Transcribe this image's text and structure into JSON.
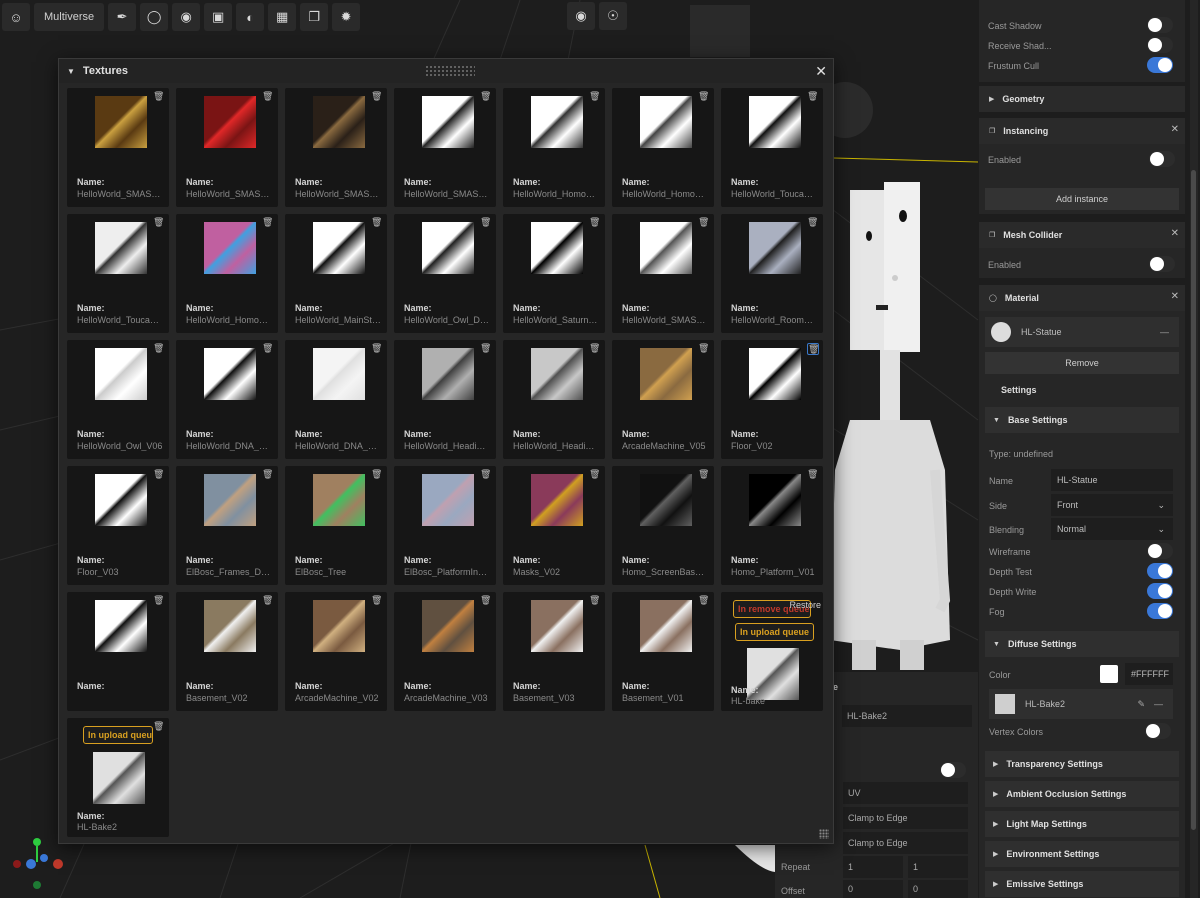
{
  "toolbar": {
    "left_text": "Multiverse",
    "icons": [
      "user-icon",
      "brush-icon",
      "bulb-icon",
      "palette-icon",
      "clapper-icon",
      "sphere-icon",
      "checker-icon",
      "copy-icon",
      "pattern-icon"
    ],
    "right_icons": [
      "orbit-icon",
      "eye-icon"
    ]
  },
  "textures": {
    "title": "Textures",
    "name_label": "Name:",
    "restore": "Restore",
    "in_upload_queue": "In upload queue",
    "in_remove_queue": "In remove queue",
    "items": [
      "HelloWorld_SMASH_...",
      "HelloWorld_SMASH_F...",
      "HelloWorld_SMASH_T...",
      "HelloWorld_SMASH_V...",
      "HelloWorld_Homo_St...",
      "HelloWorld_Homo_St...",
      "HelloWorld_ToucanSt...",
      "HelloWorld_ToucanRo...",
      "HelloWorld_Homo_M...",
      "HelloWorld_MainStat...",
      "HelloWorld_Owl_Diffu...",
      "HelloWorld_Saturn_Di...",
      "HelloWorld_SMASH_V...",
      "HelloWorld_Room_Tu...",
      "HelloWorld_Owl_V06",
      "HelloWorld_DNA_V01",
      "HelloWorld_DNA_V02",
      "HelloWorld_Headings",
      "HelloWorld_Headings...",
      "ArcadeMachine_V05",
      "Floor_V02",
      "Floor_V03",
      "ElBosc_Frames_Diffu...",
      "ElBosc_Tree",
      "ElBosc_PlatformInner...",
      "Masks_V02",
      "Homo_ScreenBase_V01",
      "Homo_Platform_V01",
      "",
      "Basement_V02",
      "ArcadeMachine_V02",
      "ArcadeMachine_V03",
      "Basement_V03",
      "Basement_V01",
      "HL-bake",
      "HL-Bake2"
    ]
  },
  "right_panel": {
    "cast_shadow": "Cast Shadow",
    "receive_shadow": "Receive Shad...",
    "frustum_cull": "Frustum Cull",
    "geometry": "Geometry",
    "instancing": "Instancing",
    "enabled": "Enabled",
    "add_instance": "Add instance",
    "mesh_collider": "Mesh Collider",
    "material": "Material",
    "material_name": "HL-Statue",
    "remove": "Remove",
    "settings": "Settings",
    "base_settings": "Base Settings",
    "type": "Type: undefined",
    "name_label": "Name",
    "name_value": "HL-Statue",
    "side_label": "Side",
    "side_value": "Front",
    "blending_label": "Blending",
    "blending_value": "Normal",
    "wireframe": "Wireframe",
    "depth_test": "Depth Test",
    "depth_write": "Depth Write",
    "fog": "Fog",
    "diffuse_settings": "Diffuse Settings",
    "color_label": "Color",
    "color_value": "#FFFFFF",
    "map_name": "HL-Bake2",
    "vertex_colors": "Vertex Colors",
    "transparency": "Transparency Settings",
    "ao": "Ambient Occlusion Settings",
    "lightmap": "Light Map Settings",
    "environment": "Environment Settings",
    "emissive": "Emissive Settings"
  },
  "behind_panel": {
    "name_value": "HL-Bake2",
    "uv": "UV",
    "wrap1": "Clamp to Edge",
    "wrap2": "Clamp to Edge",
    "repeat_label": "Repeat",
    "repeat_x": "1",
    "repeat_y": "1",
    "offset_label": "Offset",
    "offset_x": "0",
    "offset_y": "0"
  },
  "colors": {
    "accent": "#3a78d8",
    "queue": "#d9a020",
    "remove": "#c0392b"
  }
}
